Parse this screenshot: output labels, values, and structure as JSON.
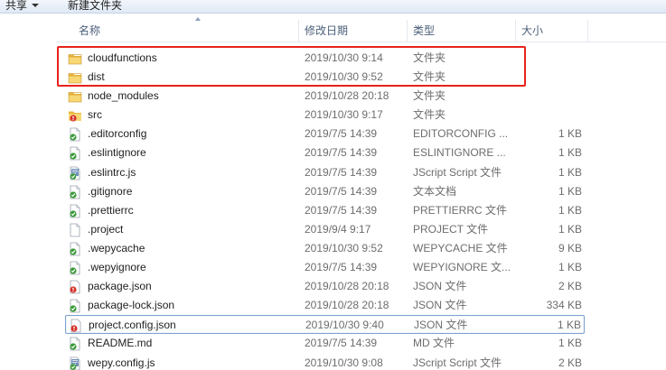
{
  "toolbar": {
    "share_label": "共享",
    "new_folder_label": "新建文件夹"
  },
  "columns": {
    "name": "名称",
    "date": "修改日期",
    "type": "类型",
    "size": "大小"
  },
  "files": [
    {
      "name": "cloudfunctions",
      "date": "2019/10/30 9:14",
      "type": "文件夹",
      "size": "",
      "icon": "folder-icon"
    },
    {
      "name": "dist",
      "date": "2019/10/30 9:52",
      "type": "文件夹",
      "size": "",
      "icon": "folder-icon"
    },
    {
      "name": "node_modules",
      "date": "2019/10/28 20:18",
      "type": "文件夹",
      "size": "",
      "icon": "folder-icon"
    },
    {
      "name": "src",
      "date": "2019/10/30 9:17",
      "type": "文件夹",
      "size": "",
      "icon": "folder-icon"
    },
    {
      "name": ".editorconfig",
      "date": "2019/7/5 14:39",
      "type": "EDITORCONFIG ...",
      "size": "1 KB",
      "icon": "file-icon"
    },
    {
      "name": ".eslintignore",
      "date": "2019/7/5 14:39",
      "type": "ESLINTIGNORE ...",
      "size": "1 KB",
      "icon": "file-icon"
    },
    {
      "name": ".eslintrc.js",
      "date": "2019/7/5 14:39",
      "type": "JScript Script 文件",
      "size": "1 KB",
      "icon": "script-file-icon"
    },
    {
      "name": ".gitignore",
      "date": "2019/7/5 14:39",
      "type": "文本文档",
      "size": "1 KB",
      "icon": "file-icon"
    },
    {
      "name": ".prettierrc",
      "date": "2019/7/5 14:39",
      "type": "PRETTIERRC 文件",
      "size": "1 KB",
      "icon": "file-icon"
    },
    {
      "name": ".project",
      "date": "2019/9/4 9:17",
      "type": "PROJECT 文件",
      "size": "1 KB",
      "icon": "blank-file-icon"
    },
    {
      "name": ".wepycache",
      "date": "2019/10/30 9:52",
      "type": "WEPYCACHE 文件",
      "size": "9 KB",
      "icon": "file-icon"
    },
    {
      "name": ".wepyignore",
      "date": "2019/7/5 14:39",
      "type": "WEPYIGNORE 文...",
      "size": "1 KB",
      "icon": "file-icon"
    },
    {
      "name": "package.json",
      "date": "2019/10/28 20:18",
      "type": "JSON 文件",
      "size": "2 KB",
      "icon": "file-icon"
    },
    {
      "name": "package-lock.json",
      "date": "2019/10/28 20:18",
      "type": "JSON 文件",
      "size": "334 KB",
      "icon": "file-icon"
    },
    {
      "name": "project.config.json",
      "date": "2019/10/30 9:40",
      "type": "JSON 文件",
      "size": "1 KB",
      "icon": "file-icon"
    },
    {
      "name": "README.md",
      "date": "2019/7/5 14:39",
      "type": "MD 文件",
      "size": "1 KB",
      "icon": "file-icon"
    },
    {
      "name": "wepy.config.js",
      "date": "2019/10/30 9:08",
      "type": "JScript Script 文件",
      "size": "2 KB",
      "icon": "script-file-icon"
    }
  ],
  "colors": {
    "annotation_box": "#e8221c",
    "selection_border": "#7da2ce",
    "folder_yellow": "#f0c24e"
  }
}
